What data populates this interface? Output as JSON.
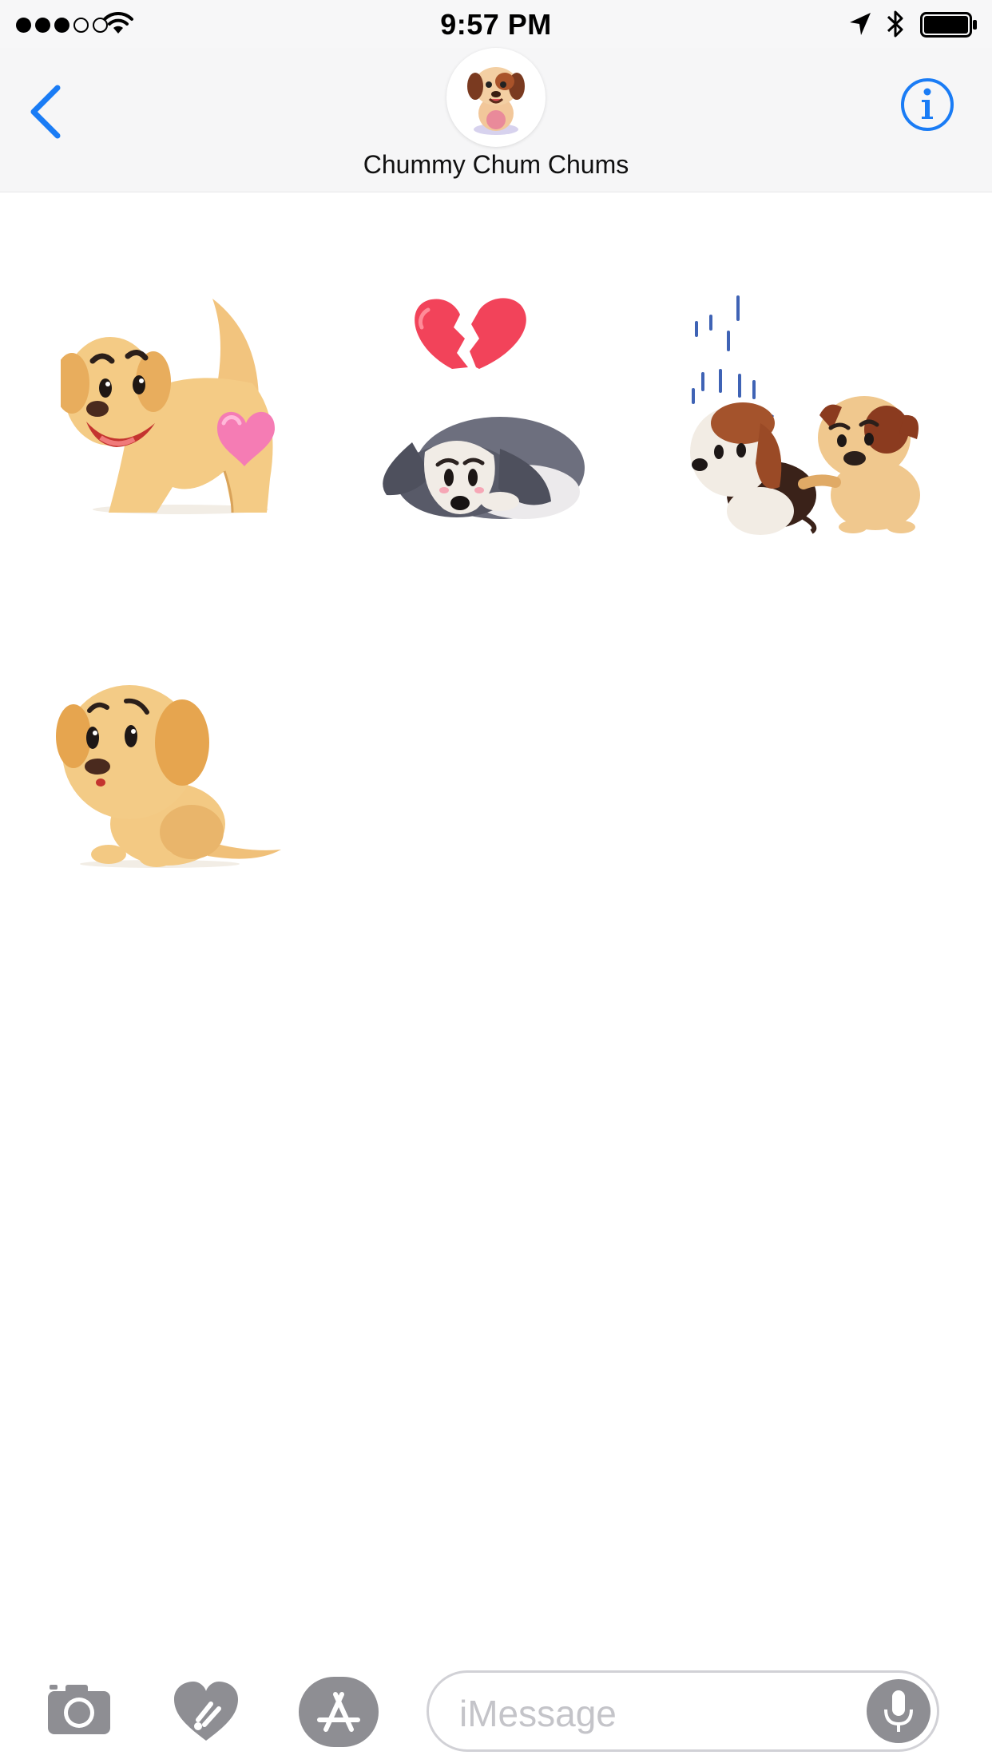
{
  "status_bar": {
    "time": "9:57 PM",
    "signal_bars_filled": 3,
    "signal_bars_total": 5,
    "icons": [
      "wifi-icon",
      "location-arrow-icon",
      "bluetooth-icon",
      "battery-icon"
    ]
  },
  "header": {
    "title": "Chummy Chum Chums",
    "back_icon": "chevron-left-icon",
    "info_icon": "info-icon"
  },
  "stickers": [
    {
      "description": "puppy-with-heart-butt"
    },
    {
      "description": "sad-dog-broken-heart"
    },
    {
      "description": "two-puppies-rain"
    },
    {
      "description": "sad-sitting-puppy"
    }
  ],
  "composer": {
    "placeholder": "iMessage",
    "icons": [
      "camera-icon",
      "digital-touch-heart-icon",
      "app-store-icon",
      "microphone-icon"
    ]
  },
  "colors": {
    "accent": "#1a7cf5",
    "toolbar_gray": "#8e8e93",
    "nav_bg": "#f6f6f7"
  }
}
